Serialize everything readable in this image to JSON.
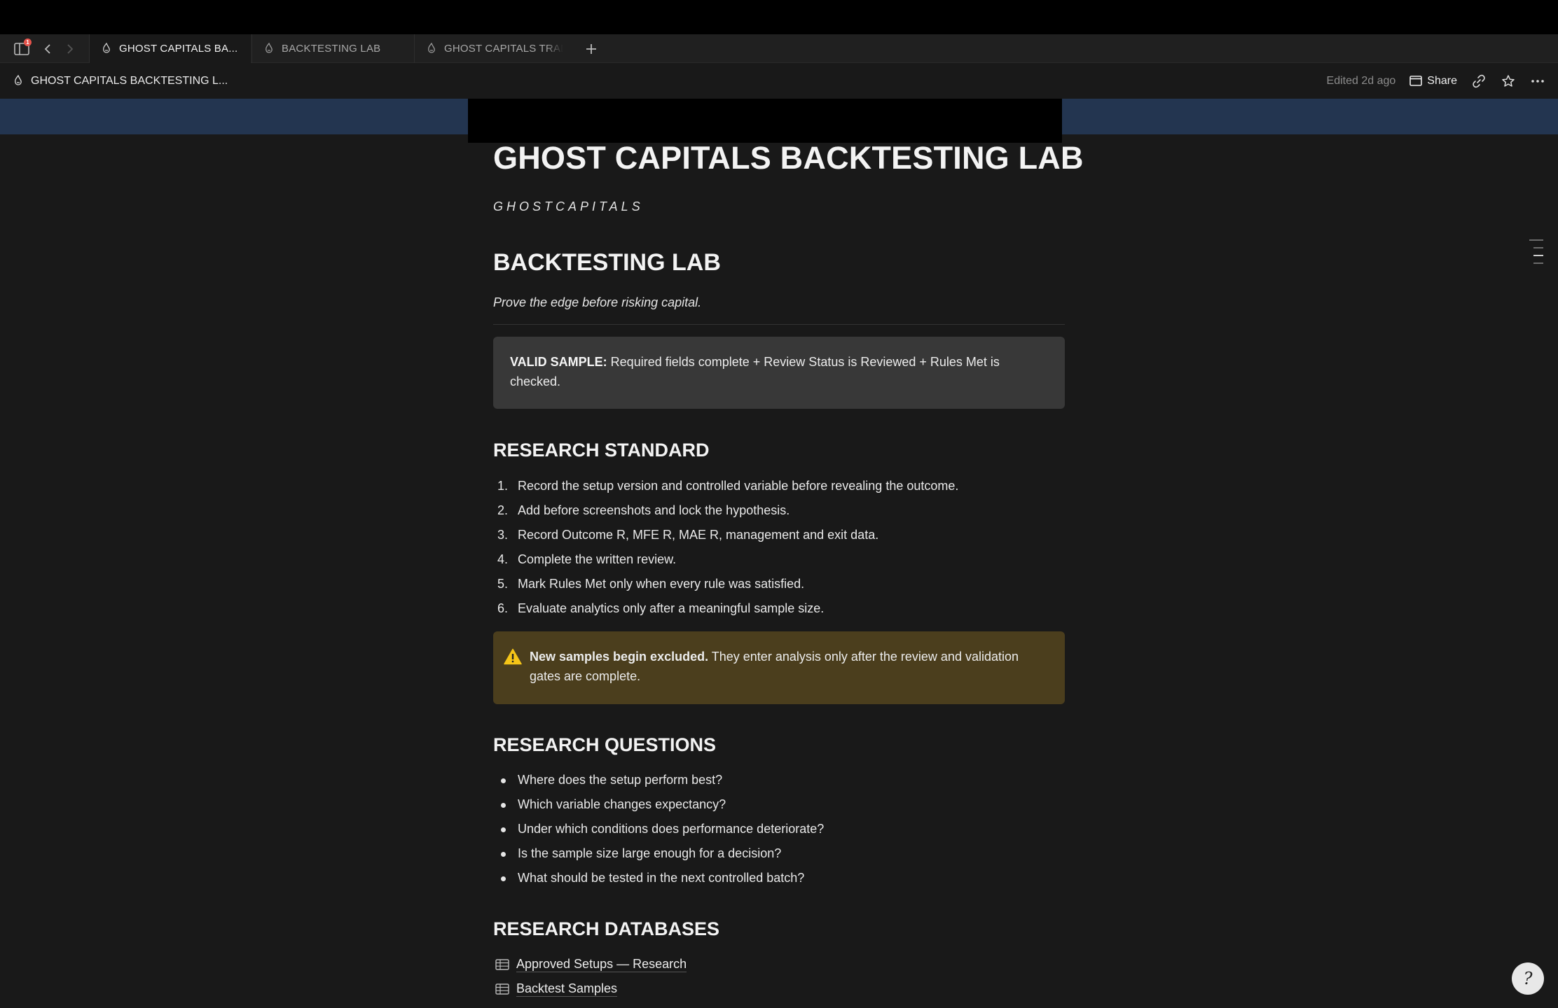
{
  "tabs": [
    {
      "label": "GHOST CAPITALS BA...",
      "active": true
    },
    {
      "label": "BACKTESTING LAB",
      "active": false
    },
    {
      "label": "GHOST CAPITALS TRADING",
      "active": false
    }
  ],
  "sidebar_badge": "1",
  "header": {
    "breadcrumb": "GHOST CAPITALS BACKTESTING L...",
    "edited": "Edited 2d ago",
    "share": "Share"
  },
  "page": {
    "title": "GHOST CAPITALS BACKTESTING LAB",
    "subtitle": "GHOSTCAPITALS",
    "heading": "BACKTESTING LAB",
    "tagline": "Prove the edge before risking capital.",
    "valid_callout": {
      "label": "VALID SAMPLE:",
      "text": " Required fields complete + Review Status is Reviewed + Rules Met is checked."
    },
    "standard": {
      "heading": "RESEARCH STANDARD",
      "items": [
        "Record the setup version and controlled variable before revealing the outcome.",
        "Add before screenshots and lock the hypothesis.",
        "Record Outcome R, MFE R, MAE R, management and exit data.",
        "Complete the written review.",
        "Mark Rules Met only when every rule was satisfied.",
        "Evaluate analytics only after a meaningful sample size."
      ]
    },
    "warn_callout": {
      "bold": "New samples begin excluded.",
      "text": " They enter analysis only after the review and validation gates are complete."
    },
    "questions": {
      "heading": "RESEARCH QUESTIONS",
      "items": [
        "Where does the setup perform best?",
        "Which variable changes expectancy?",
        "Under which conditions does performance deteriorate?",
        "Is the sample size large enough for a decision?",
        "What should be tested in the next controlled batch?"
      ]
    },
    "databases": {
      "heading": "RESEARCH DATABASES",
      "items": [
        "Approved Setups — Research",
        "Backtest Samples"
      ]
    }
  },
  "help_glyph": "?"
}
